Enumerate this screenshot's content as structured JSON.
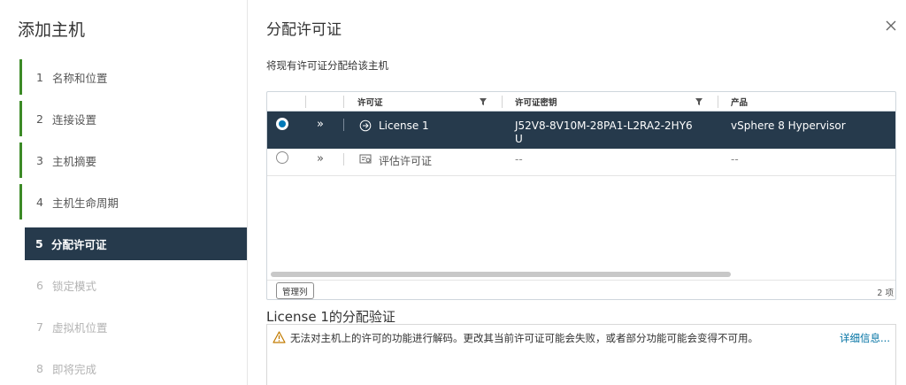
{
  "nav": {
    "title": "添加主机",
    "steps": [
      {
        "num": "1",
        "label": "名称和位置"
      },
      {
        "num": "2",
        "label": "连接设置"
      },
      {
        "num": "3",
        "label": "主机摘要"
      },
      {
        "num": "4",
        "label": "主机生命周期"
      },
      {
        "num": "5",
        "label": "分配许可证"
      },
      {
        "num": "6",
        "label": "锁定模式"
      },
      {
        "num": "7",
        "label": "虚拟机位置"
      },
      {
        "num": "8",
        "label": "即将完成"
      }
    ]
  },
  "main": {
    "title": "分配许可证",
    "subtitle": "将现有许可证分配给该主机"
  },
  "grid": {
    "columns": [
      "许可证",
      "许可证密钥",
      "产品"
    ],
    "rows": [
      {
        "selected": true,
        "license": "License 1",
        "key_line1": "J52V8-8V10M-28PA1-L2RA2-2HY6",
        "key_line2": "U",
        "product": "vSphere 8 Hypervisor",
        "icon": "arrow-circle-icon"
      },
      {
        "selected": false,
        "license": "评估许可证",
        "key": "--",
        "product": "--",
        "icon": "eval-license-icon"
      }
    ],
    "manage_columns_label": "管理列",
    "count_label": "2 项"
  },
  "validation": {
    "title": "License 1的分配验证",
    "message": "无法对主机上的许可的功能进行解码。更改其当前许可证可能会失败，或者部分功能可能会变得不可用。",
    "details_link": "详细信息..."
  },
  "colors": {
    "selected_row": "#263a4c",
    "step_done": "#3c8a26",
    "link": "#0072a3",
    "warning": "#c27b00"
  }
}
